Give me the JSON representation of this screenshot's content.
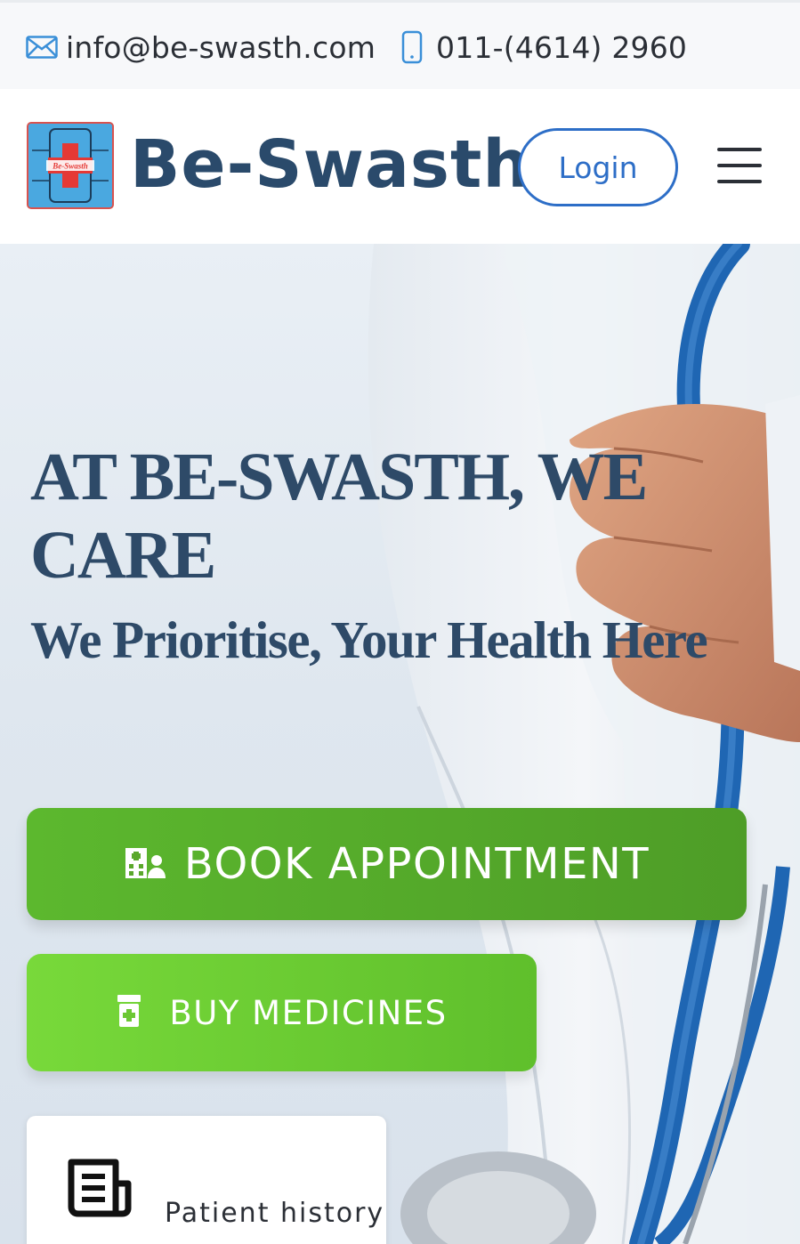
{
  "topbar": {
    "email": "info@be-swasth.com",
    "phone": "011-(4614) 2960",
    "email_icon": "envelope-icon",
    "phone_icon": "mobile-phone-icon"
  },
  "header": {
    "logo_text": "Be-Swasth",
    "brand": "Be-Swasth",
    "login_label": "Login",
    "menu_icon": "hamburger-menu-icon"
  },
  "hero": {
    "title": "AT BE-SWASTH, WE CARE",
    "subtitle": "We Prioritise, Your Health Here",
    "book_button": {
      "label": "BOOK APPOINTMENT",
      "icon": "hospital-user-icon"
    },
    "medicine_button": {
      "label": "BUY MEDICINES",
      "icon": "prescription-bottle-icon"
    },
    "card": {
      "label": "Patient history",
      "icon": "newspaper-icon"
    }
  },
  "colors": {
    "brand_navy": "#2a4a6b",
    "link_blue": "#2d6ec7",
    "green_dark": "#4e9d27",
    "green_light": "#78d93a"
  }
}
